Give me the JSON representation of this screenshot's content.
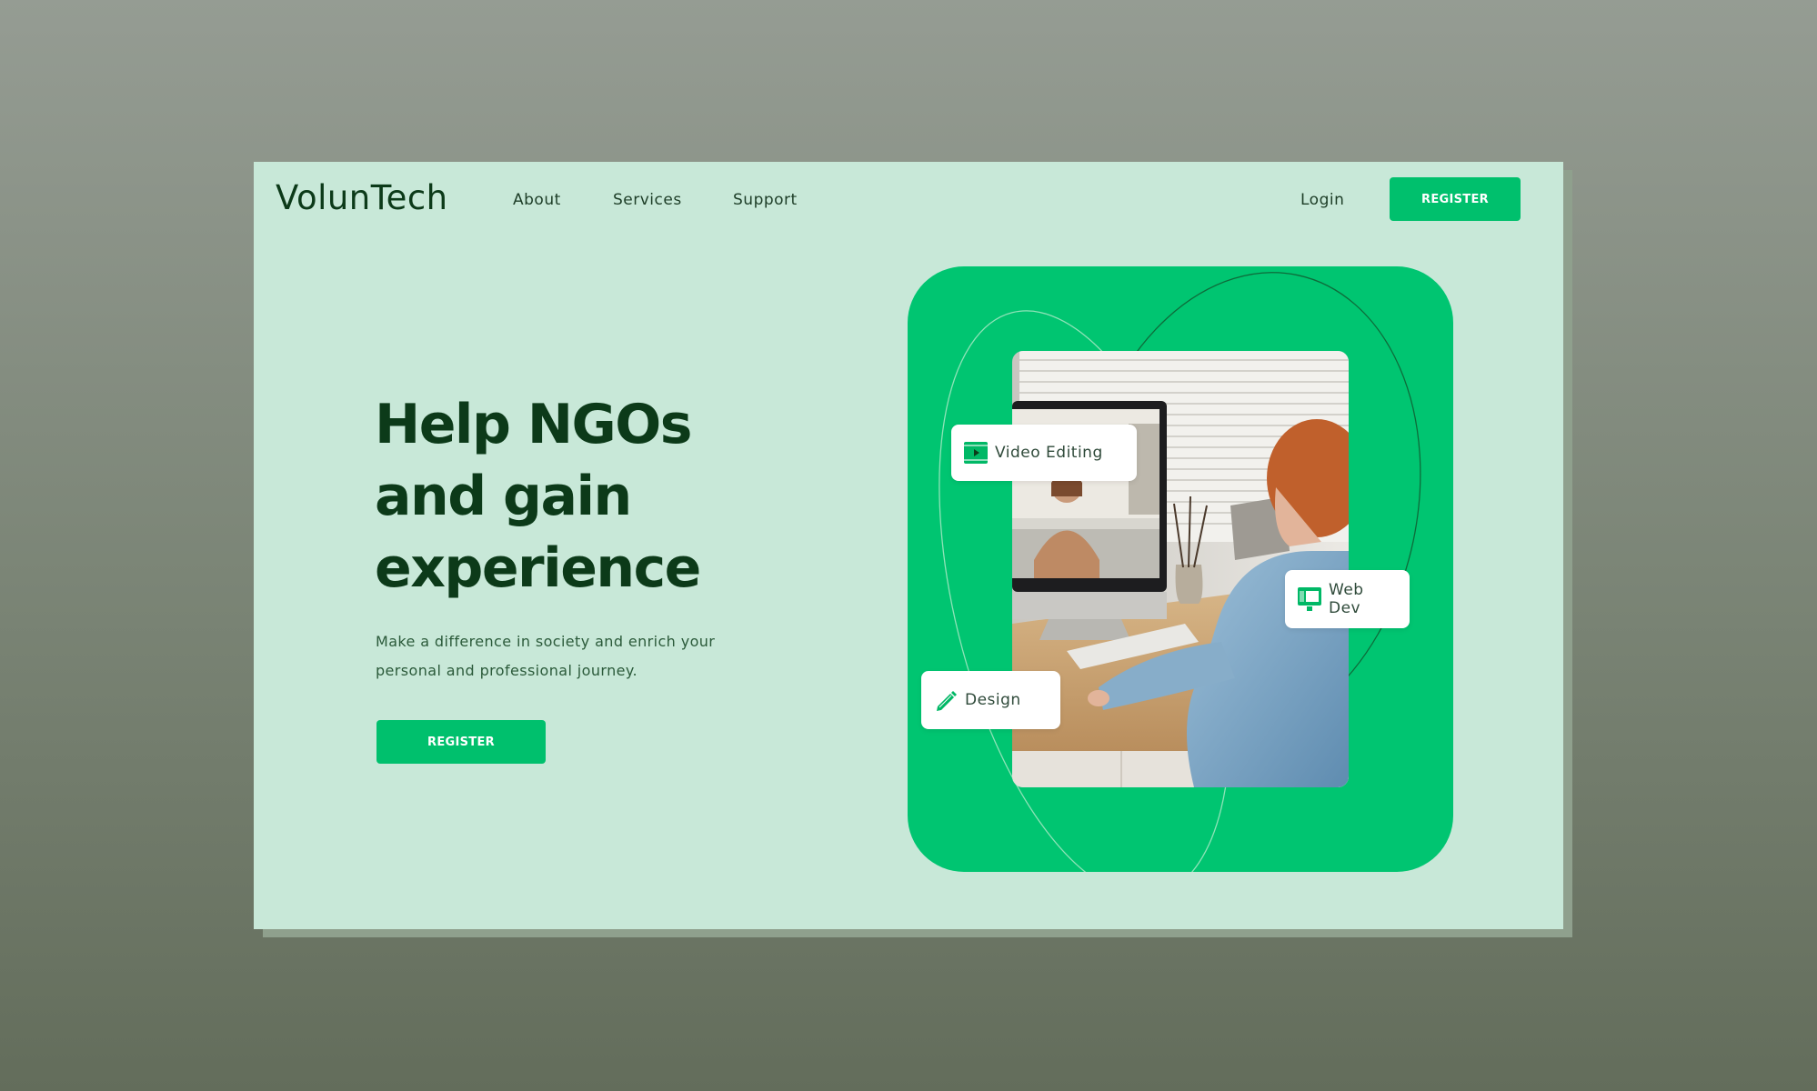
{
  "brand": {
    "logo": "VolunTech",
    "accent_color": "#00c06d",
    "dark_green": "#0c3a19",
    "background_mint": "#c8e8d8"
  },
  "nav": {
    "links": [
      "About",
      "Services",
      "Support"
    ],
    "login": "Login",
    "register": "REGISTER"
  },
  "hero": {
    "headline_lines": [
      "Help NGOs",
      "and gain",
      "experience"
    ],
    "subtext_lines": [
      "Make a difference in society and enrich your",
      "personal and professional journey."
    ],
    "cta": "REGISTER"
  },
  "skills": [
    {
      "label": "Video Editing",
      "icon": "film-icon"
    },
    {
      "label": "Web Dev",
      "icon": "monitor-icon"
    },
    {
      "label": "Design",
      "icon": "pencil-icon"
    }
  ]
}
